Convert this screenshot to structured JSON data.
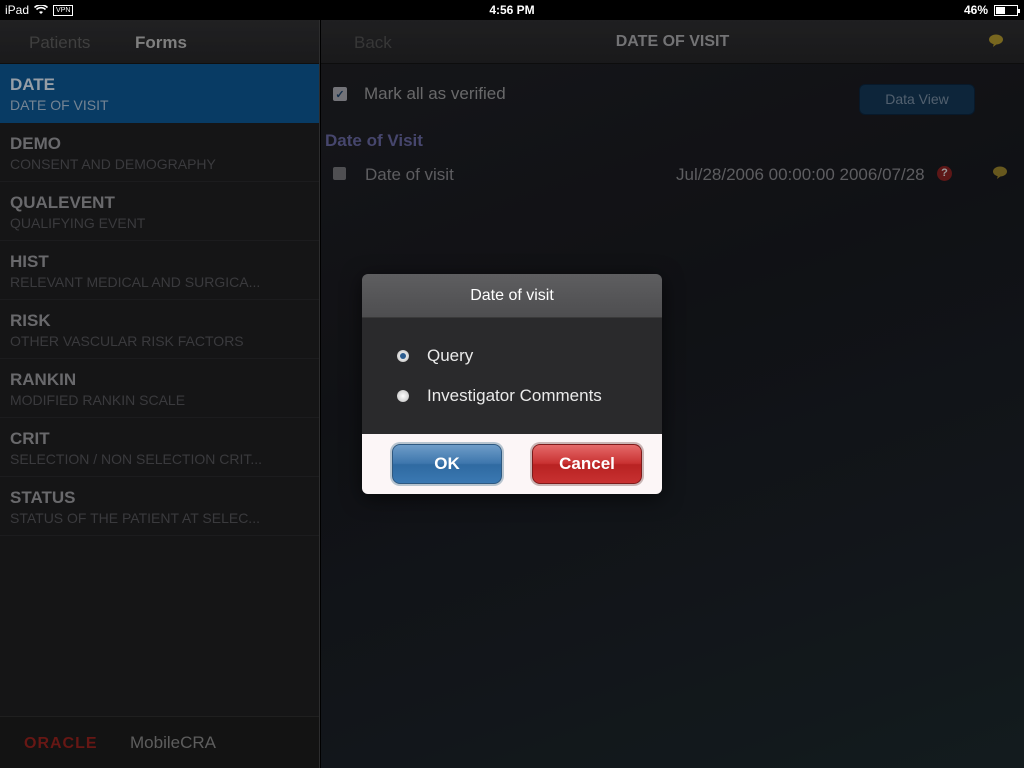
{
  "status_bar": {
    "device": "iPad",
    "vpn": "VPN",
    "time": "4:56 PM",
    "battery": "46%",
    "battery_level": 0.46
  },
  "left_panel": {
    "tabs": {
      "patients": "Patients",
      "forms": "Forms"
    },
    "forms": [
      {
        "code": "DATE",
        "desc": "DATE OF VISIT",
        "selected": true
      },
      {
        "code": "DEMO",
        "desc": "CONSENT AND DEMOGRAPHY"
      },
      {
        "code": "QUALEVENT",
        "desc": "QUALIFYING EVENT"
      },
      {
        "code": "HIST",
        "desc": "RELEVANT MEDICAL AND SURGICA..."
      },
      {
        "code": "RISK",
        "desc": "OTHER VASCULAR RISK FACTORS"
      },
      {
        "code": "RANKIN",
        "desc": "MODIFIED RANKIN SCALE"
      },
      {
        "code": "CRIT",
        "desc": "SELECTION / NON SELECTION CRIT..."
      },
      {
        "code": "STATUS",
        "desc": "STATUS OF THE PATIENT AT SELEC..."
      }
    ],
    "footer": {
      "brand": "ORACLE",
      "product": "MobileCRA"
    }
  },
  "main": {
    "back": "Back",
    "title": "DATE OF VISIT",
    "mark_all_label": "Mark all as verified",
    "mark_all_checked": true,
    "data_view": "Data View",
    "section_title": "Date of Visit",
    "field": {
      "label": "Date of visit",
      "value": "Jul/28/2006 00:00:00 2006/07/28",
      "help": "?"
    }
  },
  "dialog": {
    "title": "Date of visit",
    "options": [
      {
        "label": "Query",
        "selected": true
      },
      {
        "label": "Investigator Comments",
        "selected": false
      }
    ],
    "ok": "OK",
    "cancel": "Cancel"
  },
  "colors": {
    "selection_blue": "#0b4f86",
    "ok_blue": "#3e77ad",
    "cancel_red": "#c93232",
    "brand_red": "#8a1f1b"
  }
}
